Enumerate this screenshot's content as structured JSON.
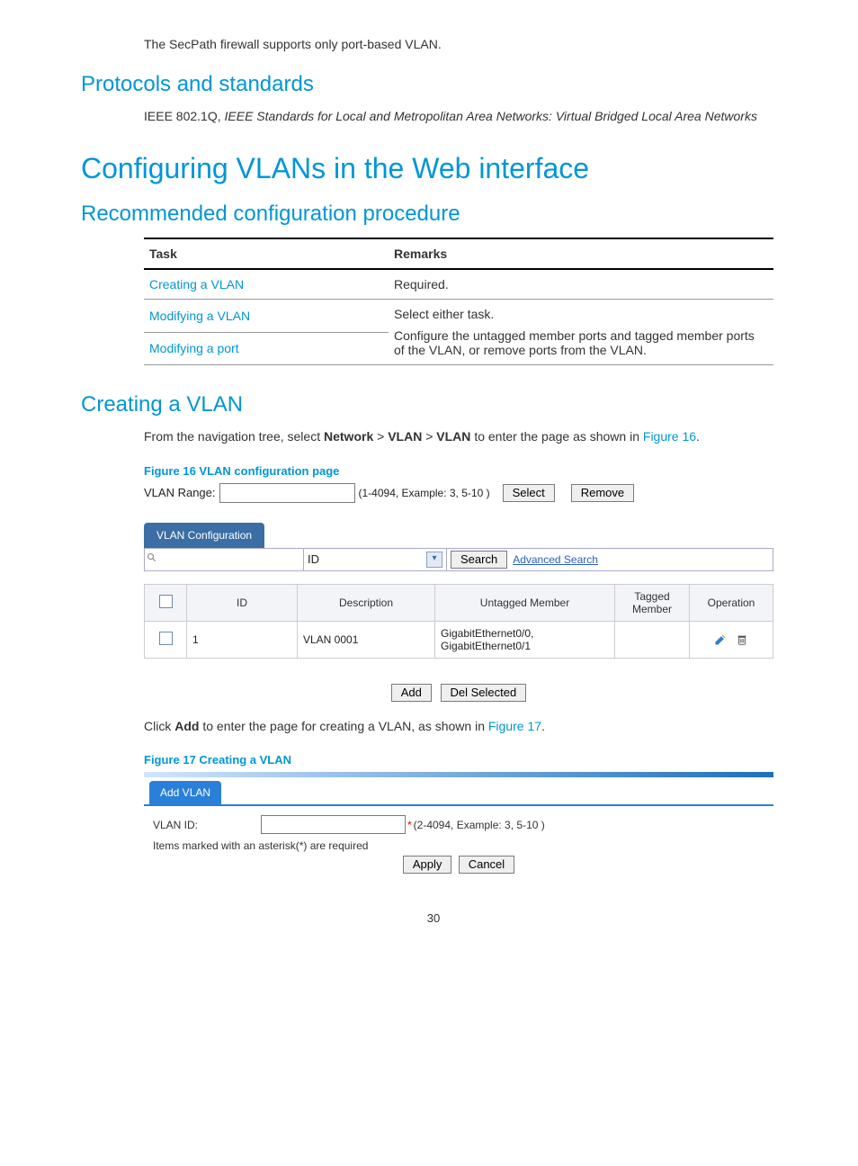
{
  "intro_text": "The SecPath firewall supports only port-based VLAN.",
  "h2_protocols": "Protocols and standards",
  "protocols_text_prefix": "IEEE 802.1Q, ",
  "protocols_text_italic": "IEEE Standards for Local and Metropolitan Area Networks: Virtual Bridged Local Area Networks",
  "h1_config": "Configuring VLANs in the Web interface",
  "h2_recommended": "Recommended configuration procedure",
  "task_table": {
    "head_task": "Task",
    "head_remarks": "Remarks",
    "rows": [
      {
        "task": "Creating a VLAN",
        "remarks": "Required."
      },
      {
        "task": "Modifying a VLAN",
        "remarks": "Select either task."
      },
      {
        "task": "Modifying a port",
        "remarks": "Configure the untagged member ports and tagged member ports of the VLAN, or remove ports from the VLAN."
      }
    ]
  },
  "h2_creating": "Creating a VLAN",
  "nav_text_prefix": "From the navigation tree, select ",
  "nav_network": "Network",
  "nav_vlan1": "VLAN",
  "nav_vlan2": "VLAN",
  "nav_text_mid": " to enter the page as shown in ",
  "nav_fig16_link": "Figure 16",
  "fig16_caption": "Figure 16 VLAN configuration page",
  "fig16": {
    "range_label": "VLAN Range:",
    "range_hint": "(1-4094, Example: 3, 5-10 )",
    "select_btn": "Select",
    "remove_btn": "Remove",
    "tab_label": "VLAN Configuration",
    "id_select_label": "ID",
    "search_btn": "Search",
    "adv_search": "Advanced Search",
    "cols": {
      "id": "ID",
      "desc": "Description",
      "untagged": "Untagged Member",
      "tagged": "Tagged Member",
      "op": "Operation"
    },
    "row": {
      "id": "1",
      "desc": "VLAN 0001",
      "untagged": "GigabitEthernet0/0, GigabitEthernet0/1",
      "tagged": ""
    },
    "add_btn": "Add",
    "del_btn": "Del Selected"
  },
  "click_add_prefix": "Click ",
  "click_add_bold": "Add",
  "click_add_mid": " to enter the page for creating a VLAN, as shown in ",
  "click_add_fig17": "Figure 17",
  "fig17_caption": "Figure 17 Creating a VLAN",
  "fig17": {
    "tab_label": "Add VLAN",
    "id_label": "VLAN ID:",
    "id_hint": "(2-4094, Example: 3, 5-10 )",
    "note": "Items marked with an asterisk(*) are required",
    "apply_btn": "Apply",
    "cancel_btn": "Cancel"
  },
  "page_num": "30"
}
